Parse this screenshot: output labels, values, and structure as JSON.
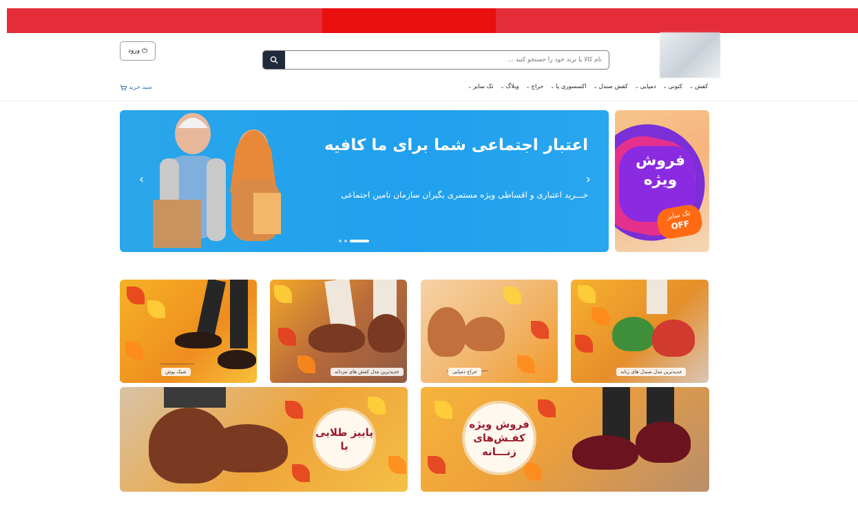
{
  "header": {
    "login_label": "ورود",
    "search_placeholder": "نام کالا یا برند خود را جستجو کنید ...",
    "cart_label": "سبد خرید"
  },
  "nav": {
    "items": [
      {
        "label": "کفش"
      },
      {
        "label": "کتونی"
      },
      {
        "label": "دمپایی"
      },
      {
        "label": "کفش صندل"
      },
      {
        "label": "اکسسوری پا"
      },
      {
        "label": "حراج"
      },
      {
        "label": "وبلاگ"
      },
      {
        "label": "تک سایز"
      }
    ]
  },
  "hero": {
    "title": "اعتبار اجتماعی شما برای ما کافیه",
    "subtitle": "خـــرید اعتباری و اقساطی ویژه مستمری بگیران سازمان تامین اجتماعی",
    "slides_count": 3,
    "active_slide": 3
  },
  "side_banner": {
    "title_line1": "فروش",
    "title_line2": "ویژه",
    "badge_line1": "تک سایز",
    "badge_line2": "OFF"
  },
  "tiles": [
    {
      "label": "شیک پوش"
    },
    {
      "label": "جدیدترین مدل کفش های مردانه"
    },
    {
      "label": "حراج دمپایی"
    },
    {
      "label": "جدیدترین مدل صندل های زنانه"
    }
  ],
  "wide_tiles": [
    {
      "line1": "پاییز طلایی",
      "line2": "با"
    },
    {
      "line1": "فروش ویژه",
      "line2": "کفـش‌های",
      "line3": "زنـــانه"
    }
  ],
  "colors": {
    "topbar": "#e52d3a",
    "topbar_center": "#ea1010",
    "search_button": "#1f2a3b",
    "hero_bg": "#20a0ee",
    "cart_link": "#2f6fc0"
  }
}
